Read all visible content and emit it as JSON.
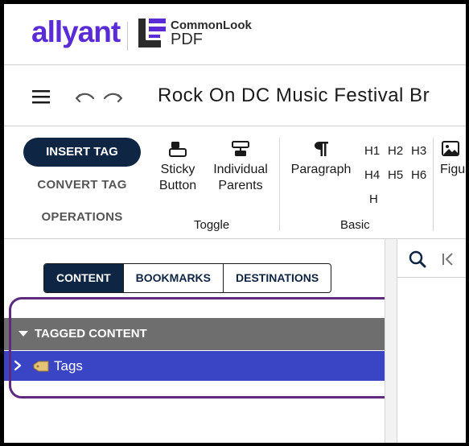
{
  "brand": {
    "allyant": "allyant",
    "product_line1": "CommonLook",
    "product_line2": "PDF"
  },
  "titlebar": {
    "document_title": "Rock On DC Music Festival Br"
  },
  "ribbon": {
    "modes": {
      "insert_tag": "INSERT TAG",
      "convert_tag": "CONVERT TAG",
      "operations": "OPERATIONS"
    },
    "toggle": {
      "sticky_button": [
        "Sticky",
        "Button"
      ],
      "individual_parents": [
        "Individual",
        "Parents"
      ],
      "group_label": "Toggle"
    },
    "basic": {
      "paragraph": "Paragraph",
      "headings": [
        "H1",
        "H2",
        "H3",
        "H4",
        "H5",
        "H6",
        "H"
      ],
      "group_label": "Basic"
    },
    "figure": "Figu"
  },
  "left_panel": {
    "tabs": [
      "CONTENT",
      "BOOKMARKS",
      "DESTINATIONS"
    ],
    "active_tab": "CONTENT",
    "tree_header": "TAGGED CONTENT",
    "tree_items": [
      {
        "label": "Tags"
      }
    ]
  },
  "colors": {
    "brand_purple": "#5b2bd6",
    "navy": "#0f2544",
    "selection_blue": "#3a45c6",
    "header_gray": "#6e6e6e",
    "highlight_purple": "#5d2a7e"
  }
}
